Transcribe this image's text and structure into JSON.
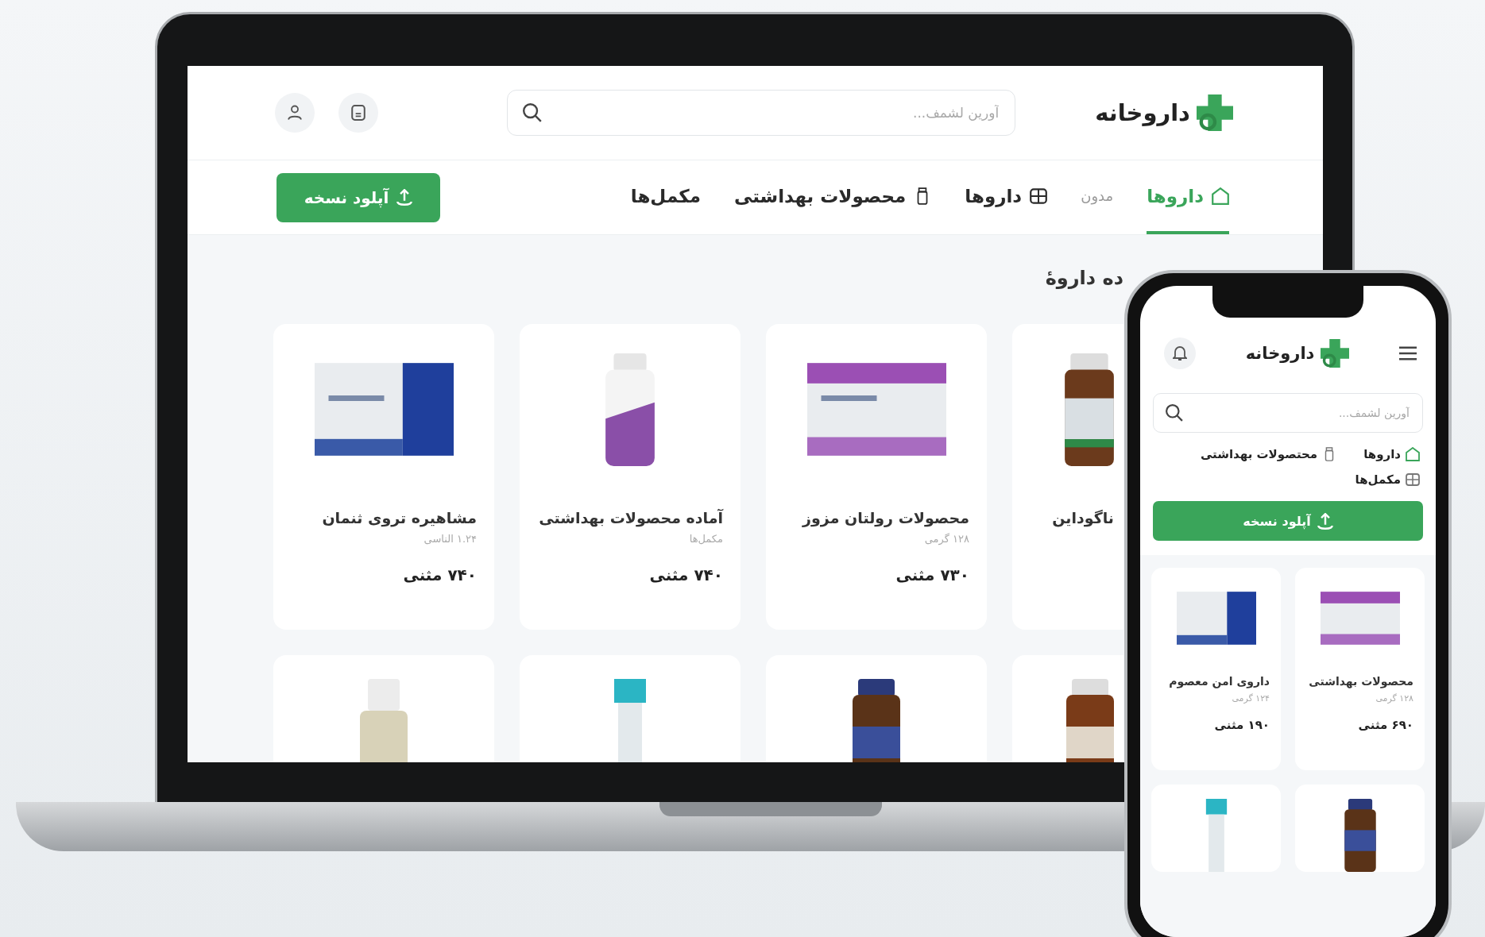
{
  "desktop": {
    "logo": "داروخانه",
    "search": {
      "placeholder": "آورین لشمف..."
    },
    "nav": [
      {
        "label": "داروها",
        "kind": "home",
        "selected": true
      },
      {
        "label": "مدون",
        "kind": "plain",
        "selected": false
      },
      {
        "label": "داروها",
        "kind": "grid",
        "selected": false
      },
      {
        "label": "محصولات بهداشتی",
        "kind": "bottle",
        "selected": false
      },
      {
        "label": "مکمل‌ها",
        "kind": "plain",
        "selected": false
      }
    ],
    "upload_button": "آپلود نسخه",
    "section_title": "ده داروهٔ",
    "products": [
      {
        "name": "ناگوداین",
        "kind": "jar"
      },
      {
        "name": "محصولات رولتان مزوز",
        "subtitle": "۱۲۸ گرمی",
        "price": "۷۳۰ مثنی",
        "kind": "purplebox"
      },
      {
        "name": "آماده محصولات بهداشتی",
        "subtitle": "مکمل‌ها",
        "price": "۷۴۰ مثنی",
        "kind": "bottle"
      },
      {
        "name": "مشاهیره تروی ثنمان",
        "subtitle": "۱.۲۴ الناسی",
        "price": "۷۴۰ مثنی",
        "kind": "bluebox"
      }
    ],
    "more_products": [
      {
        "kind": "jar"
      },
      {
        "kind": "bluejar"
      },
      {
        "kind": "tube"
      },
      {
        "kind": "dropper"
      }
    ]
  },
  "mobile": {
    "logo": "داروخانه",
    "search": {
      "placeholder": "آورین لشمف..."
    },
    "nav": [
      {
        "label": "داروها",
        "kind": "home"
      },
      {
        "label": "محتصولات بهداشتی",
        "kind": "bottle"
      },
      {
        "label": "مکمل‌ها",
        "kind": "grid"
      }
    ],
    "upload_button": "آپلود نسخه",
    "products": [
      {
        "name": "محصولات بهداشتی",
        "subtitle": "۱۲۸ گرمی",
        "price": "۶۹۰ مثنی",
        "kind": "purplebox"
      },
      {
        "name": "داروی امن معصوم",
        "subtitle": "۱۲۴ گرمی",
        "price": "۱۹۰ مثنی",
        "kind": "bluebox"
      }
    ],
    "more_products": [
      {
        "kind": "bluejar"
      },
      {
        "kind": "tube"
      }
    ]
  }
}
